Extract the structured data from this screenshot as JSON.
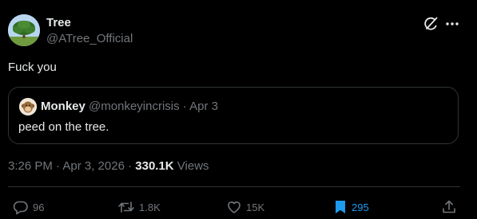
{
  "author": {
    "name": "Tree",
    "handle": "@ATree_Official",
    "avatar_icon": "tree-avatar"
  },
  "tweet": {
    "text": "Fuck you"
  },
  "quoted": {
    "name": "Monkey",
    "handle": "@monkeyincrisis",
    "separator": "·",
    "date": "Apr 3",
    "text": "peed on the tree.",
    "avatar_icon": "monkey-avatar"
  },
  "meta": {
    "timestamp": "3:26 PM · Apr 3, 2026 · ",
    "views_count": "330.1K",
    "views_label": " Views"
  },
  "actions": {
    "replies": "96",
    "reposts": "1.8K",
    "likes": "15K",
    "bookmarks": "295"
  },
  "icons": {
    "grok": "grok-icon",
    "more": "more-icon",
    "reply": "reply-icon",
    "repost": "repost-icon",
    "like": "heart-icon",
    "bookmark": "bookmark-icon",
    "share": "share-icon"
  },
  "colors": {
    "background": "#000000",
    "text": "#e7e9ea",
    "muted": "#71767b",
    "border": "#2f3336",
    "accent": "#1d9bf0"
  }
}
